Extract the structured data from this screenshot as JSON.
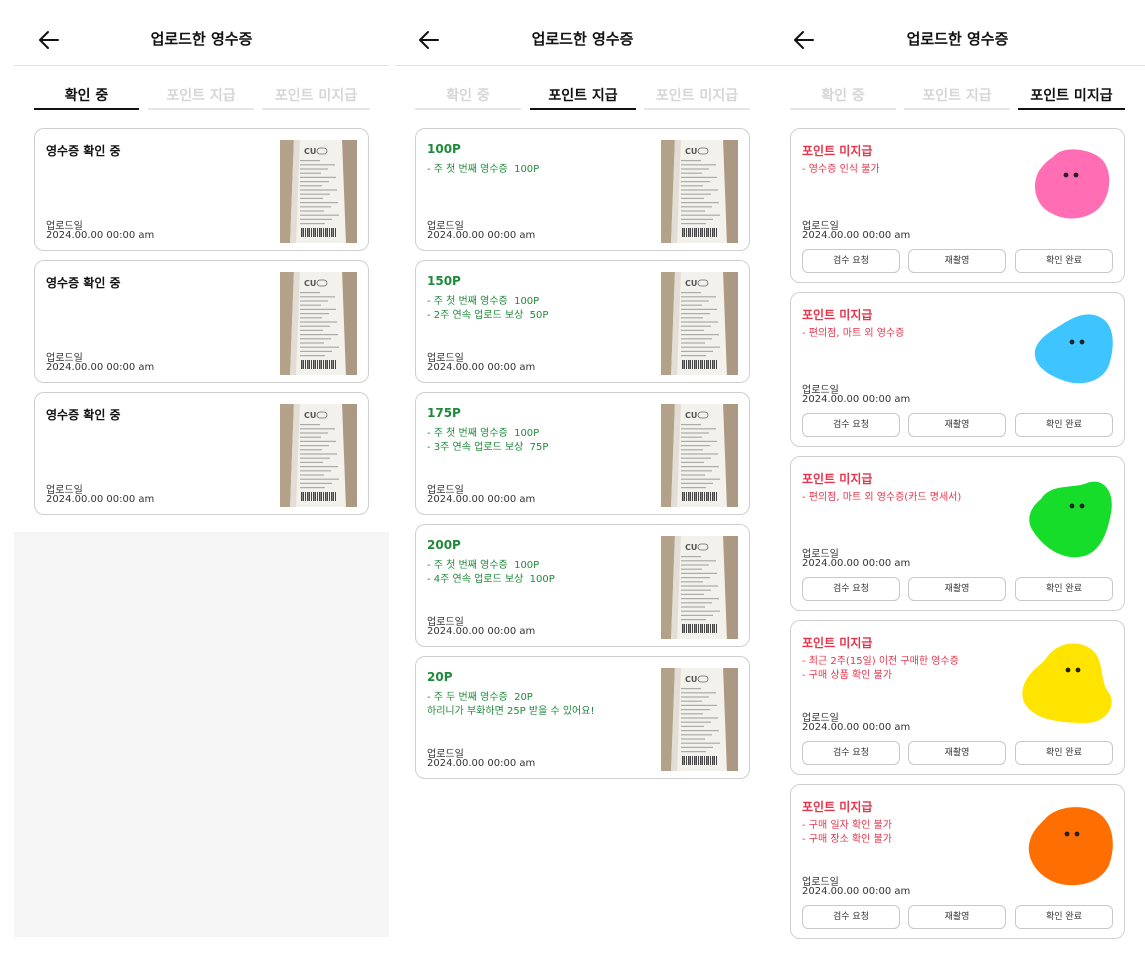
{
  "screens": [
    {
      "title": "업로드한 영수증",
      "tabs": [
        "확인 중",
        "포인트 지급",
        "포인트 미지급"
      ],
      "active_tab": "확인 중",
      "cards": [
        {
          "title": "영수증 확인 중",
          "upload_label": "업로드일",
          "upload_date": "2024.00.00 00:00 am"
        },
        {
          "title": "영수증 확인 중",
          "upload_label": "업로드일",
          "upload_date": "2024.00.00 00:00 am"
        },
        {
          "title": "영수증 확인 중",
          "upload_label": "업로드일",
          "upload_date": "2024.00.00 00:00 am"
        }
      ]
    },
    {
      "title": "업로드한 영수증",
      "tabs": [
        "확인 중",
        "포인트 지급",
        "포인트 미지급"
      ],
      "active_tab": "포인트 지급",
      "cards": [
        {
          "points": "100P",
          "details": "- 주 첫 번째 영수증  100P",
          "upload_label": "업로드일",
          "upload_date": "2024.00.00 00:00 am"
        },
        {
          "points": "150P",
          "details": "- 주 첫 번째 영수증  100P\n- 2주 연속 업로드 보상  50P",
          "upload_label": "업로드일",
          "upload_date": "2024.00.00 00:00 am"
        },
        {
          "points": "175P",
          "details": "- 주 첫 번째 영수증  100P\n- 3주 연속 업로드 보상  75P",
          "upload_label": "업로드일",
          "upload_date": "2024.00.00 00:00 am"
        },
        {
          "points": "200P",
          "details": "- 주 첫 번째 영수증  100P\n- 4주 연속 업로드 보상  100P",
          "upload_label": "업로드일",
          "upload_date": "2024.00.00 00:00 am"
        },
        {
          "points": "20P",
          "details": "- 주 두 번째 영수증  20P\n하리니가 부화하면 25P 받을 수 있어요!",
          "upload_label": "업로드일",
          "upload_date": "2024.00.00 00:00 am"
        }
      ]
    },
    {
      "title": "업로드한 영수증",
      "tabs": [
        "확인 중",
        "포인트 지급",
        "포인트 미지급"
      ],
      "active_tab": "포인트 미지급",
      "cards": [
        {
          "title": "포인트 미지급",
          "reasons": "- 영수증 인식 불가",
          "upload_label": "업로드일",
          "upload_date": "2024.00.00 00:00 am",
          "blob_color": "#ff6eb4",
          "buttons": [
            "검수 요청",
            "재촬영",
            "확인 완료"
          ]
        },
        {
          "title": "포인트 미지급",
          "reasons": "- 편의점, 마트 외 영수증",
          "upload_label": "업로드일",
          "upload_date": "2024.00.00 00:00 am",
          "blob_color": "#3ec5ff",
          "buttons": [
            "검수 요청",
            "재촬영",
            "확인 완료"
          ]
        },
        {
          "title": "포인트 미지급",
          "reasons": "- 편의점, 마트 외 영수증(카드 명세서)",
          "upload_label": "업로드일",
          "upload_date": "2024.00.00 00:00 am",
          "blob_color": "#16dc2a",
          "buttons": [
            "검수 요청",
            "재촬영",
            "확인 완료"
          ]
        },
        {
          "title": "포인트 미지급",
          "reasons": "- 최근 2주(15일) 이전 구매한 영수증\n- 구매 상품 확인 불가",
          "upload_label": "업로드일",
          "upload_date": "2024.00.00 00:00 am",
          "blob_color": "#ffe400",
          "buttons": [
            "검수 요청",
            "재촬영",
            "확인 완료"
          ]
        },
        {
          "title": "포인트 미지급",
          "reasons": "- 구매 일자 확인 불가\n- 구매 장소 확인 불가",
          "upload_label": "업로드일",
          "upload_date": "2024.00.00 00:00 am",
          "blob_color": "#ff6e00",
          "buttons": [
            "검수 요청",
            "재촬영",
            "확인 완료"
          ]
        }
      ]
    }
  ],
  "colors": {
    "green": "#1e8a3a",
    "red": "#e8344a",
    "inactive_tab": "#d6d6d6",
    "card_border": "#cfcfcf",
    "empty_area": "#f5f5f5"
  },
  "icons": {
    "back": "arrow-left",
    "receipt_logo": "CU"
  }
}
